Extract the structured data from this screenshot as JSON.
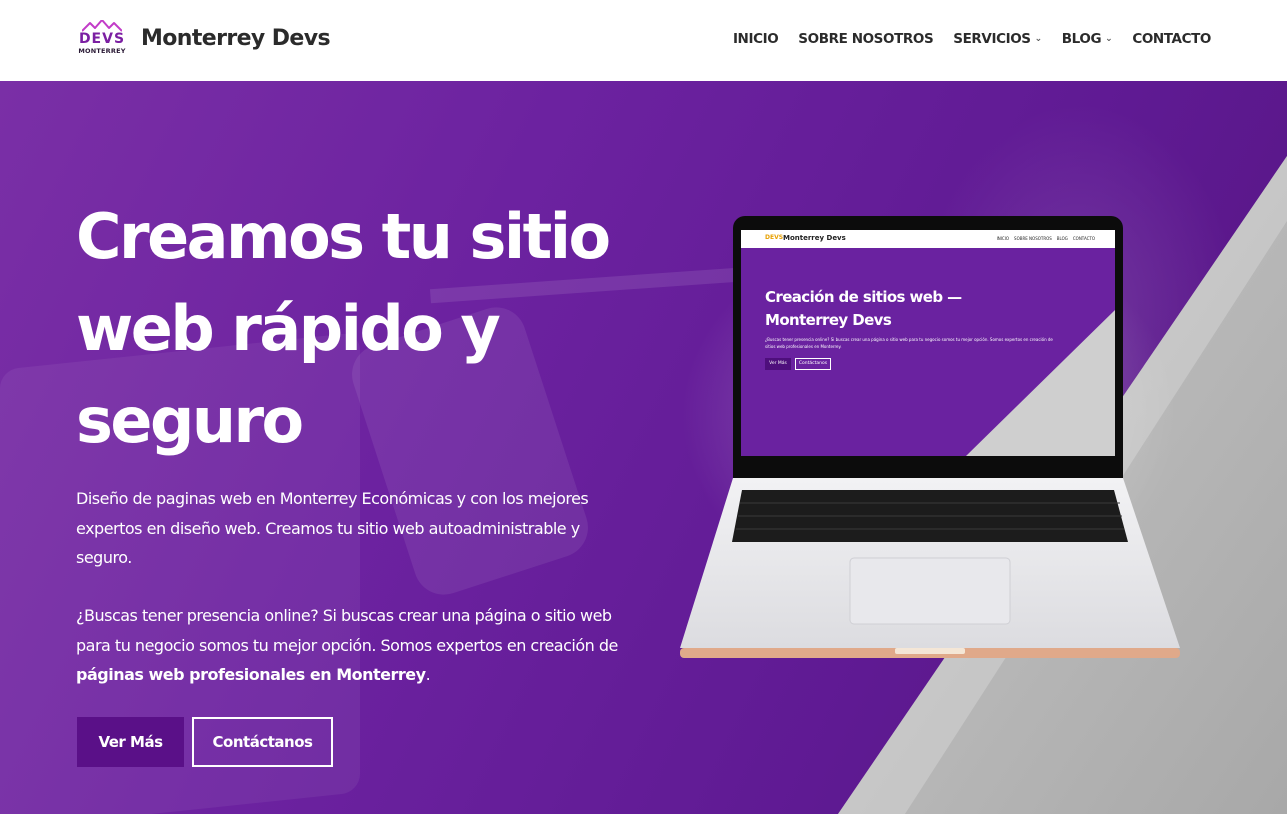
{
  "header": {
    "logo": {
      "mark_text": "DEVS",
      "sub_text": "MONTERREY"
    },
    "site_name": "Monterrey Devs",
    "nav": [
      {
        "label": "INICIO",
        "has_dropdown": false
      },
      {
        "label": "SOBRE NOSOTROS",
        "has_dropdown": false
      },
      {
        "label": "SERVICIOS",
        "has_dropdown": true
      },
      {
        "label": "BLOG",
        "has_dropdown": true
      },
      {
        "label": "CONTACTO",
        "has_dropdown": false
      }
    ]
  },
  "hero": {
    "title": "Creamos tu sitio web rápido y seguro",
    "paragraph1": "Diseño de paginas web en Monterrey Económicas y con los mejores expertos en diseño web. Creamos tu sitio web autoadministrable y seguro.",
    "paragraph2_start": "¿Buscas tener presencia online? Si buscas crear una página o sitio web para tu negocio somos tu mejor opción. Somos expertos en creación de ",
    "paragraph2_bold": "páginas web profesionales en Monterrey",
    "paragraph2_end": ".",
    "buttons": {
      "primary": "Ver Más",
      "secondary": "Contáctanos"
    }
  },
  "laptop_screen": {
    "logo": "DEVS",
    "site_name": "Monterrey Devs",
    "nav": [
      "INICIO",
      "SOBRE NOSOTROS",
      "BLOG",
      "CONTACTO"
    ],
    "title": "Creación de sitios web — Monterrey Devs",
    "description": "¿Buscas tener presencia online? Si buscas crear una página o sitio web para tu negocio somos tu mejor opción. Somos expertos en creación de sitios web profesionales en Monterrey.",
    "button_primary": "Ver Más",
    "button_secondary": "Contáctanos"
  },
  "colors": {
    "brand_purple": "#6c22a0",
    "button_purple": "#5a1088",
    "logo_purple": "#7b1fa2",
    "text_dark": "#2b2b2b",
    "grey_accent": "#d9d9d9"
  },
  "icons": {
    "logo_mark": "mountains-icon",
    "dropdown": "chevron-down-icon"
  }
}
